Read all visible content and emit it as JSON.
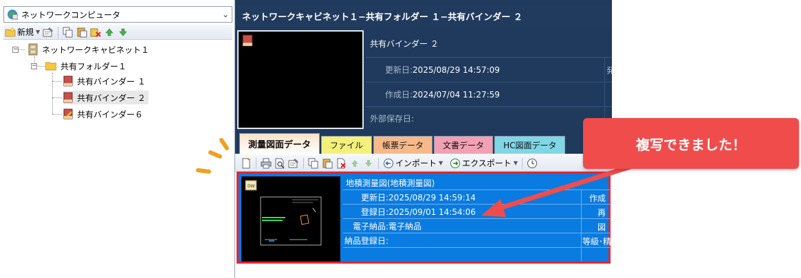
{
  "combo": {
    "label": "ネットワークコンピュータ"
  },
  "left_toolbar": {
    "new_label": "新規"
  },
  "tree": {
    "root": "ネットワークキャビネット１",
    "folder": "共有フォルダー１",
    "binders": [
      "共有バインダー １",
      "共有バインダー ２",
      "共有バインダー６"
    ]
  },
  "right": {
    "title": "ネットワークキャビネット１−共有フォルダー １−共有バインダー ２",
    "binder_name": "共有バインダー ２",
    "updated_label": "更新日:",
    "updated_value": "2025/08/29 14:57:09",
    "created_label": "作成日:",
    "created_value": "2024/07/04 11:27:59",
    "external_label": "外部保存日:",
    "cut_col_text": "発",
    "tabs": [
      {
        "label": "測量図面データ",
        "color": "#fde2c8"
      },
      {
        "label": "ファイル",
        "color": "#f5f07a"
      },
      {
        "label": "帳票データ",
        "color": "#f7b98a"
      },
      {
        "label": "文書データ",
        "color": "#f2a0b3"
      },
      {
        "label": "HC図面データ",
        "color": "#7fd6e6"
      }
    ],
    "toolbar": {
      "import_label": "インポート",
      "export_label": "エクスポート"
    },
    "record": {
      "title": "地積測量図(地積測量図)",
      "updated": "更新日:2025/08/29 14:59:14",
      "registered": "登録日:2025/09/01 14:54:06",
      "delivery": "電子納品:電子納品",
      "delivery_date": "納品登録日:",
      "right_col": [
        "作成",
        "再",
        "図",
        "等級･精"
      ]
    }
  },
  "callout": {
    "text": "複写できました！",
    "color": "#f04c4c"
  }
}
